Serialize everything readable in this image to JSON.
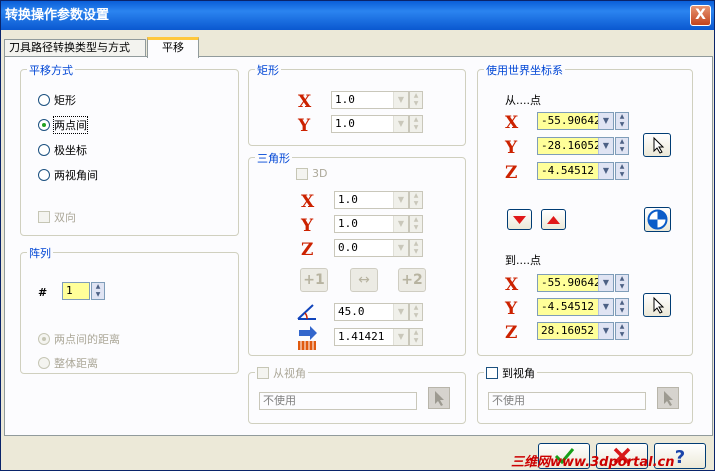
{
  "window": {
    "title": "转换操作参数设置",
    "close_symbol": "X"
  },
  "tabs": [
    {
      "label": "刀具路径转换类型与方式"
    },
    {
      "label": "平移"
    }
  ],
  "translate_mode": {
    "title": "平移方式",
    "options": [
      "矩形",
      "两点间",
      "极坐标",
      "两视角间"
    ],
    "selected": "两点间",
    "bidirectional": "双向"
  },
  "array": {
    "title": "阵列",
    "hash": "#",
    "count": "1",
    "options": [
      "两点间的距离",
      "整体距离"
    ]
  },
  "rectangle": {
    "title": "矩形",
    "x": {
      "label": "X",
      "value": "1.0"
    },
    "y": {
      "label": "Y",
      "value": "1.0"
    }
  },
  "triangle": {
    "title": "三角形",
    "three_d": "3D",
    "x": {
      "label": "X",
      "value": "1.0"
    },
    "y": {
      "label": "Y",
      "value": "1.0"
    },
    "z": {
      "label": "Z",
      "value": "0.0"
    },
    "buttons": [
      "+1",
      "↔",
      "+2"
    ],
    "angle": "45.0",
    "distance": "1.41421"
  },
  "from_view": {
    "label": "从视角",
    "value": "不使用"
  },
  "world_coords": {
    "title": "使用世界坐标系",
    "from_label": "从....点",
    "from": [
      {
        "label": "X",
        "value": "-55.90642"
      },
      {
        "label": "Y",
        "value": "-28.16052"
      },
      {
        "label": "Z",
        "value": "-4.54512"
      }
    ],
    "to_label": "到....点",
    "to": [
      {
        "label": "X",
        "value": "-55.90642"
      },
      {
        "label": "Y",
        "value": "-4.54512"
      },
      {
        "label": "Z",
        "value": "28.16052"
      }
    ]
  },
  "to_view": {
    "label": "到视角",
    "value": "不使用"
  },
  "watermark": "三维网www.3dportal.cn",
  "icons": {
    "select_point": "cursor-arrow-icon",
    "down": "red-down-triangle-icon",
    "up": "red-up-triangle-icon",
    "swap": "blue-globe-icon",
    "ok": "green-check-icon",
    "cancel": "red-x-icon",
    "help": "question-icon"
  },
  "colors": {
    "axis": "#cc2200",
    "group_title": "#0046d5",
    "highlight_field": "#ffff99"
  }
}
